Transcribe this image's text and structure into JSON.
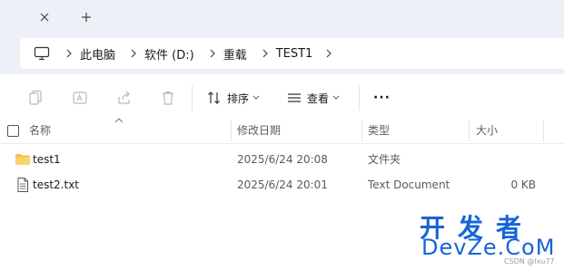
{
  "breadcrumbs": [
    "此电脑",
    "软件 (D:)",
    "重载",
    "TEST1"
  ],
  "toolbar": {
    "sort_label": "排序",
    "view_label": "查看",
    "more_label": "···"
  },
  "columns": {
    "name": "名称",
    "date": "修改日期",
    "type": "类型",
    "size": "大小"
  },
  "files": [
    {
      "name": "test1",
      "date": "2025/6/24 20:08",
      "type": "文件夹",
      "size": "",
      "icon": "folder-icon"
    },
    {
      "name": "test2.txt",
      "date": "2025/6/24 20:01",
      "type": "Text Document",
      "size": "0 KB",
      "icon": "text-file-icon"
    }
  ],
  "watermark": {
    "top": "开发者",
    "bottom": "DevZe.CoM",
    "credit": "CSDN @lxu77"
  },
  "colors": {
    "chrome_bg": "#eef0f7",
    "folder": "#f5c244",
    "watermark": "#1665d8"
  }
}
